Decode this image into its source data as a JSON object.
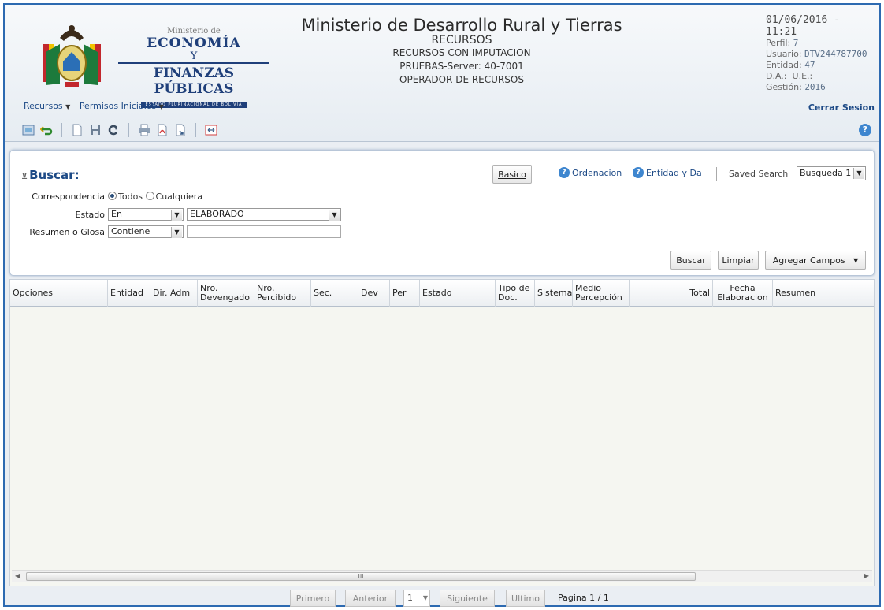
{
  "header": {
    "logo": {
      "small": "Ministerio de",
      "line1": "ECONOMÍA",
      "y": "Y",
      "line2": "FINANZAS PÚBLICAS",
      "band": "ESTADO PLURINACIONAL DE BOLIVIA"
    },
    "ministry": "Ministerio de Desarrollo Rural y Tierras",
    "module": "RECURSOS",
    "submodule": "RECURSOS CON IMPUTACION",
    "server": "PRUEBAS-Server: 40-7001",
    "role": "OPERADOR DE RECURSOS",
    "datetime": "01/06/2016 - 11:21",
    "perfil_label": "Perfil:",
    "perfil_value": "7",
    "usuario_label": "Usuario:",
    "usuario_value": "DTV244787700",
    "entidad_label": "Entidad:",
    "entidad_value": "47",
    "da_label": "D.A.:",
    "ue_label": "U.E.:",
    "gestion_label": "Gestión:",
    "gestion_value": "2016",
    "logout": "Cerrar Sesion"
  },
  "menu": {
    "items": [
      {
        "label": "Recursos"
      },
      {
        "label": "Permisos Iniciales"
      }
    ]
  },
  "toolbar": {
    "icons": [
      "browse-icon",
      "undo-icon",
      "new-document-icon",
      "save-icon",
      "refresh-icon",
      "print-icon",
      "pdf-icon",
      "export-icon",
      "fit-width-icon"
    ],
    "help_icon": "?"
  },
  "search": {
    "title": "Buscar:",
    "basico": "Basico",
    "ordenacion": "Ordenacion",
    "entidad": "Entidad y Da",
    "saved_label": "Saved Search",
    "saved_value": "Busqueda 1",
    "correspondencia_label": "Correspondencia",
    "todos": "Todos",
    "cualquiera": "Cualquiera",
    "estado_label": "Estado",
    "estado_op": "En",
    "estado_value": "ELABORADO",
    "resumen_label": "Resumen o Glosa",
    "resumen_op": "Contiene",
    "resumen_value": "",
    "buscar_btn": "Buscar",
    "limpiar_btn": "Limpiar",
    "agregar_btn": "Agregar Campos"
  },
  "grid": {
    "columns": [
      "Opciones",
      "Entidad",
      "Dir. Adm",
      "Nro.\nDevengado",
      "Nro.\nPercibido",
      "Sec.",
      "Dev",
      "Per",
      "Estado",
      "Tipo de\nDoc.",
      "Sistema",
      "Medio\nPercepción",
      "Total",
      "Fecha\nElaboracion",
      "Resumen"
    ],
    "scroll_mark": "III"
  },
  "pager": {
    "first": "Primero",
    "prev": "Anterior",
    "page": "1",
    "next": "Siguiente",
    "last": "Ultimo",
    "label": "Pagina 1 / 1"
  }
}
